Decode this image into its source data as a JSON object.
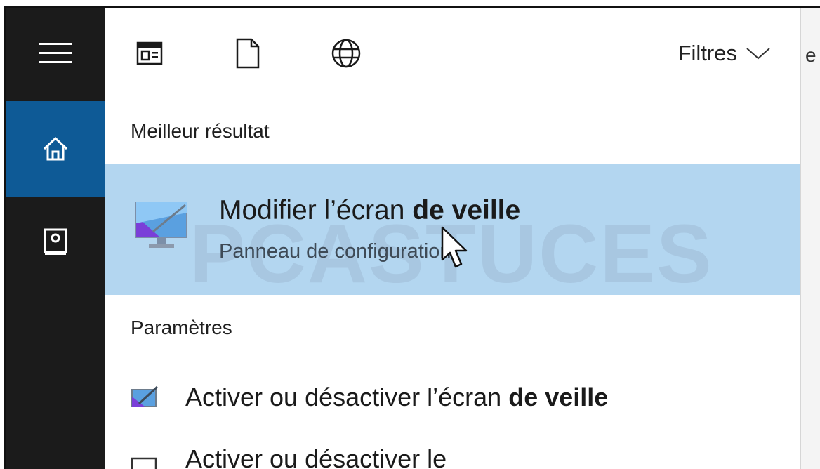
{
  "toolbar": {
    "filters_label": "Filtres",
    "icons": [
      "apps-icon",
      "documents-icon",
      "web-icon"
    ]
  },
  "rail": {
    "icons": [
      "hamburger-menu-icon",
      "home-icon",
      "notebook-icon"
    ],
    "accent_color": "#0e5a96"
  },
  "best_result": {
    "header": "Meilleur résultat",
    "title_normal": "Modifier l’écran ",
    "title_bold": "de veille",
    "subtitle": "Panneau de configuration",
    "highlight_color": "#b3d6f0"
  },
  "settings": {
    "header": "Paramètres",
    "items": [
      {
        "text_normal": "Activer ou désactiver l’écran ",
        "text_bold": "de veille"
      },
      {
        "text_normal": "Activer ou désactiver le",
        "text_bold": ""
      }
    ]
  },
  "watermark": "PCASTUCES",
  "right_edge_text": "e r"
}
